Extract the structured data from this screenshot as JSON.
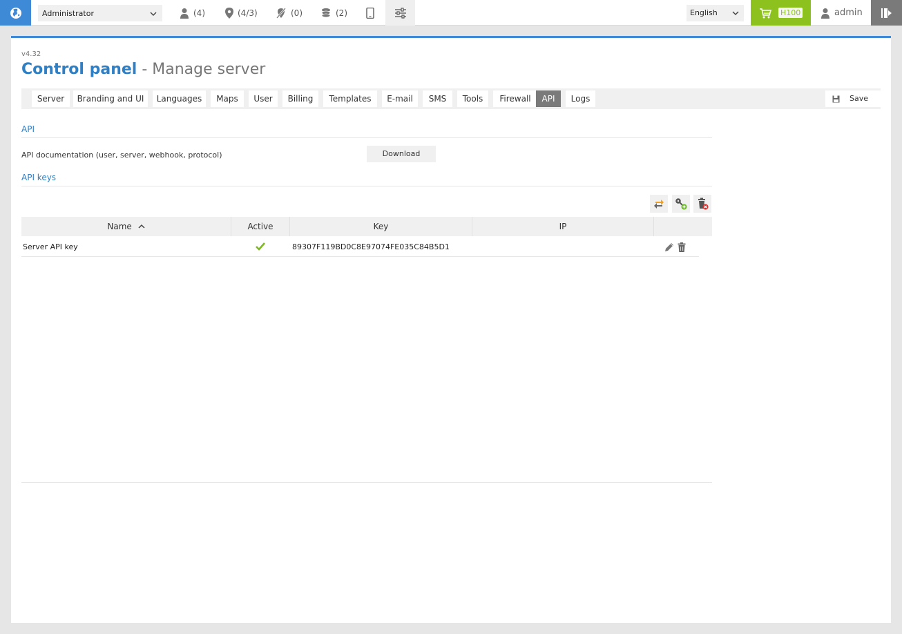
{
  "topbar": {
    "role": "Administrator",
    "stats": [
      {
        "icon": "user-icon",
        "label": "(4)"
      },
      {
        "icon": "location-pin-icon",
        "label": "(4/3)"
      },
      {
        "icon": "unassigned-icon",
        "label": "(0)"
      },
      {
        "icon": "coins-icon",
        "label": "(2)"
      }
    ],
    "language": "English",
    "cart_badge": "H100",
    "username": "admin"
  },
  "panel": {
    "version": "v4.32",
    "title_main": "Control panel",
    "title_sub": " - Manage server",
    "tabs": [
      "Server",
      "Branding and UI",
      "Languages",
      "Maps",
      "User",
      "Billing",
      "Templates",
      "E-mail",
      "SMS",
      "Tools",
      "Firewall",
      "API",
      "Logs"
    ],
    "active_tab": "API",
    "save_label": "Save"
  },
  "api": {
    "section_title": "API",
    "doc_label": "API documentation (user, server, webhook, protocol)",
    "download_label": "Download"
  },
  "api_keys": {
    "section_title": "API keys",
    "columns": [
      "Name",
      "Active",
      "Key",
      "IP"
    ],
    "rows": [
      {
        "name": "Server API key",
        "active": true,
        "key": "89307F119BD0C8E97074FE035C84B5D1",
        "ip": ""
      }
    ]
  },
  "colors": {
    "accent": "#3f8ad6",
    "title": "#2f7fc4",
    "cart": "#8dc11e",
    "active_tab": "#7a7a7a"
  }
}
